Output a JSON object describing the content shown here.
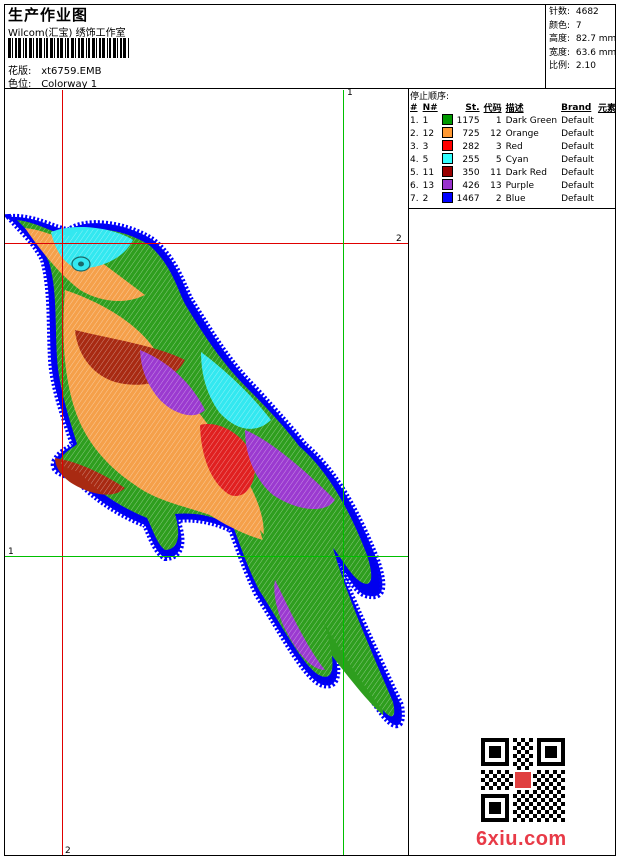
{
  "header": {
    "title": "生产作业图",
    "company": "Wilcom(汇宝) 绣饰工作室",
    "design_label": "花版:",
    "design_value": "xt6759.EMB",
    "colorway_label": "色位:",
    "colorway_value": "Colorway 1"
  },
  "stats": [
    {
      "label": "针数:",
      "value": "4682"
    },
    {
      "label": "颜色:",
      "value": "7"
    },
    {
      "label": "高度:",
      "value": "82.7 mm"
    },
    {
      "label": "宽度:",
      "value": "63.6 mm"
    },
    {
      "label": "比例:",
      "value": "2.10"
    }
  ],
  "stop_sequence_label": "停止顺序:",
  "color_table": {
    "headers": [
      "#",
      "N#",
      "St.",
      "代码",
      "描述",
      "Brand",
      "元素"
    ],
    "rows": [
      {
        "idx": "1.",
        "n": "1",
        "color": "#009900",
        "st": "1175",
        "code": "1",
        "desc": "Dark Green",
        "brand": "Default"
      },
      {
        "idx": "2.",
        "n": "12",
        "color": "#ff9933",
        "st": "725",
        "code": "12",
        "desc": "Orange",
        "brand": "Default"
      },
      {
        "idx": "3.",
        "n": "3",
        "color": "#ff0000",
        "st": "282",
        "code": "3",
        "desc": "Red",
        "brand": "Default"
      },
      {
        "idx": "4.",
        "n": "5",
        "color": "#33ffff",
        "st": "255",
        "code": "5",
        "desc": "Cyan",
        "brand": "Default"
      },
      {
        "idx": "5.",
        "n": "11",
        "color": "#990000",
        "st": "350",
        "code": "11",
        "desc": "Dark Red",
        "brand": "Default"
      },
      {
        "idx": "6.",
        "n": "13",
        "color": "#9933cc",
        "st": "426",
        "code": "13",
        "desc": "Purple",
        "brand": "Default"
      },
      {
        "idx": "7.",
        "n": "2",
        "color": "#0000ff",
        "st": "1467",
        "code": "2",
        "desc": "Blue",
        "brand": "Default"
      }
    ]
  },
  "guides": {
    "top_green_label": "1",
    "right_red_label": "2",
    "left_green_label": "1",
    "bottom_red_label": "2",
    "red_color": "#e00000",
    "green_color": "#00c000"
  },
  "watermark": "6xiu.com"
}
